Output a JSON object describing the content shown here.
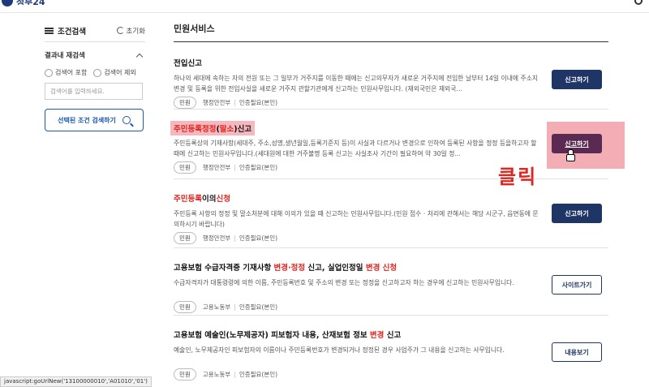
{
  "header": {
    "logo_text": "정부24",
    "search_icon": "search-icon"
  },
  "sidebar": {
    "title": "조건검색",
    "reset_label": "초기화",
    "sub_title": "결과내 재검색",
    "radio_include": "검색어 포함",
    "radio_exclude": "검색어 제외",
    "input_placeholder": "검색어를 입력하세요.",
    "apply_label": "선택된 조건 검색하기"
  },
  "main": {
    "title": "민원서비스",
    "items": [
      {
        "title": "전입신고",
        "desc": "하나의 세대에 속하는 자의 전원 또는 그 일부가 거주지를 이동한 때에는 신고의무자가 새로운 거주지에 전입한 날부터 14일 이내에 주소지변경 및 등록을 위한 전입사실을 새로운 거주지 관할기관에게 신고하는 민원사무입니다. (재외국민은 재외국...",
        "tag": "민원",
        "org": "행정안전부",
        "auth": "인증필요(본인)",
        "action": "신고하기"
      },
      {
        "title_a": "주민등록정정",
        "title_b": "(",
        "title_c": "말소",
        "title_d": ")신고",
        "desc": "주민등록상의 기재사항(세대주, 주소,성명,생년월일,등록기준지 등)이 사실과 다르거나 변경으로 인하여 등록된 사항을 정정 등을하고자 할 때에 신고하는 민원사무입니다.(세대원에 대한 거주불명 등록 신고는 사실조사 기간이 필요하여 약 30일 정...",
        "tag": "민원",
        "org": "행정안전부",
        "auth": "인증필요(본인)",
        "action": "신고하기"
      },
      {
        "title_a": "주민등록",
        "title_b": "이의",
        "title_c": "신청",
        "desc": "주민등록 사항의 정정 및 말소처분에 대해 이의가 있을 때 신고하는 민원사무입니다.(민원 접수 · 처리에 관해서는 해당 시군구, 읍면동에 문의하시기 바랍니다)",
        "tag": "민원",
        "org": "행정안전부",
        "auth": "인증필요(본인)",
        "action": "신고하기"
      },
      {
        "title_a": "고용보험 수급자격증 기재사항 ",
        "title_b": "변경",
        "title_c": "·",
        "title_d": "정정",
        "title_e": " 신고, 실업인정일 ",
        "title_f": "변경",
        "title_g": " ",
        "title_h": "신청",
        "desc": "수급자격자가 대통령령에 의한 이름, 주민등록번호 및 주소의 변경 또는 정정을 신고하고자 하는 경우에 신고하는 민원사무입니다.",
        "tag": "민원",
        "org": "고용노동부",
        "auth": "인증필요(본인)",
        "action": "사이트가기"
      },
      {
        "title_a": "고용보험 예술인(노무제공자) 피보험자 내용, 산재보험 정보 ",
        "title_b": "변경",
        "title_c": " 신고",
        "desc": "예술인, 노무제공자인 피보험자의 이름이나 주민등록번호가 변경되거나 정정된 경우 사업주가 그 내용을 신고하는 사무입니다.",
        "tag": "민원",
        "org": "고용노동부",
        "auth": "인증필요(본인)",
        "action": "내용보기"
      }
    ]
  },
  "annotation": "클릭",
  "statusbar": "javascript:goUrlNew('13100000010','A01010','01')",
  "colors": {
    "accent": "#1f3566",
    "highlight": "#f6b8be",
    "red": "#e0261f",
    "link": "#1a5ab8"
  }
}
